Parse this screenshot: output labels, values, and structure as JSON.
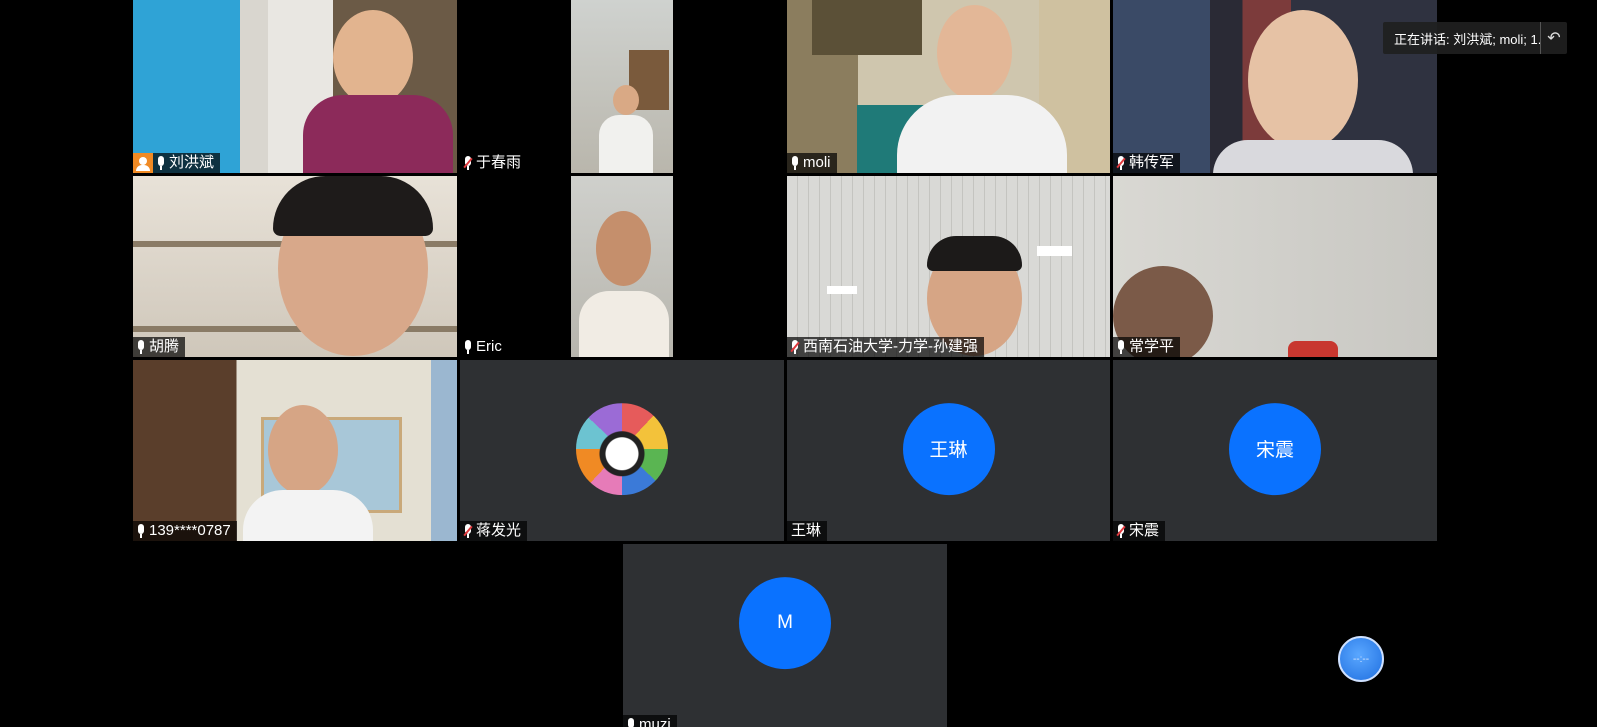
{
  "speaking": {
    "text": "正在讲话: 刘洪斌; moli; 1...",
    "back_icon": "return-arrow-icon"
  },
  "participants": [
    {
      "name": "刘洪斌",
      "mic": "on",
      "host": true
    },
    {
      "name": "于春雨",
      "mic": "muted"
    },
    {
      "name": "moli",
      "mic": "on"
    },
    {
      "name": "韩传军",
      "mic": "muted"
    },
    {
      "name": "胡腾",
      "mic": "on"
    },
    {
      "name": "Eric",
      "mic": "on"
    },
    {
      "name": "西南石油大学-力学-孙建强",
      "mic": "muted"
    },
    {
      "name": "常学平",
      "mic": "on"
    },
    {
      "name": "139****0787",
      "mic": "on"
    },
    {
      "name": "蒋发光",
      "mic": "muted",
      "avatar": "photo"
    },
    {
      "name": "王琳",
      "mic": "none",
      "avatar_text": "王琳"
    },
    {
      "name": "宋震",
      "mic": "muted",
      "avatar_text": "宋震"
    },
    {
      "name": "muzi",
      "mic": "on",
      "avatar_text": "M"
    }
  ],
  "float_button": {
    "label": "--:--"
  },
  "colors": {
    "avatar_blue": "#0a72ff",
    "active_speaker": "#39c46a",
    "host_badge": "#f08a24",
    "muted_red": "#e0393e"
  }
}
